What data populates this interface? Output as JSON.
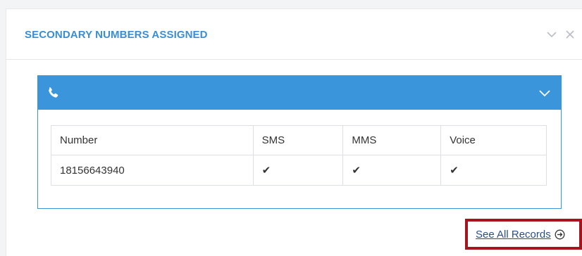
{
  "widget": {
    "title": "SECONDARY NUMBERS ASSIGNED",
    "collapse_icon": "chevron-down-icon",
    "close_icon": "close-icon"
  },
  "card": {
    "header_icon": "phone-icon",
    "toggle_icon": "chevron-down-icon",
    "accent_color": "#3a95db"
  },
  "table": {
    "columns": [
      "Number",
      "SMS",
      "MMS",
      "Voice"
    ],
    "rows": [
      {
        "number": "18156643940",
        "sms": "✔",
        "mms": "✔",
        "voice": "✔"
      }
    ]
  },
  "footer": {
    "see_all_label": "See All Records",
    "see_all_icon": "arrow-circle-right-icon",
    "highlight_color": "#a3161d"
  }
}
